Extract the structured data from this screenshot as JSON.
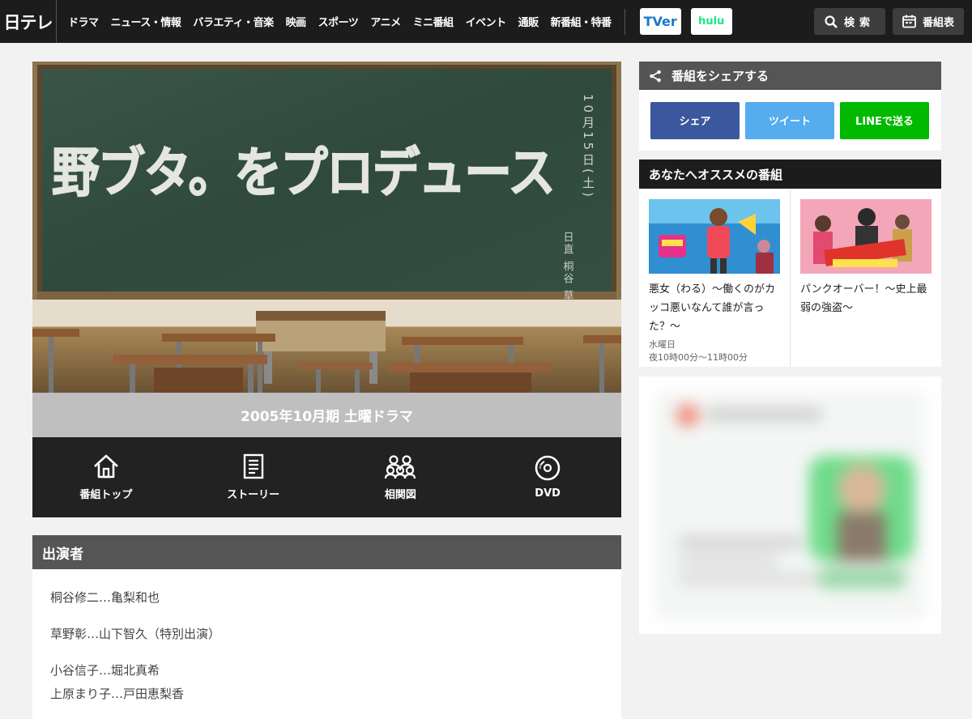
{
  "header": {
    "logo": "日テレ",
    "nav": [
      "ドラマ",
      "ニュース・情報",
      "バラエティ・音楽",
      "映画",
      "スポーツ",
      "アニメ",
      "ミニ番組",
      "イベント",
      "通販",
      "新番組・特番"
    ],
    "services": {
      "tver": "TVer",
      "hulu": "hulu"
    },
    "search_label": "検索",
    "schedule_label": "番組表"
  },
  "hero": {
    "title_chalk": "野ブタ。をプロデュース",
    "date_chalk": "10月15日(土)",
    "duty_chalk": "日直 桐谷 草野"
  },
  "season": "2005年10月期 土曜ドラマ",
  "menu": [
    {
      "label": "番組トップ",
      "icon": "home-icon"
    },
    {
      "label": "ストーリー",
      "icon": "document-icon"
    },
    {
      "label": "相関図",
      "icon": "people-icon"
    },
    {
      "label": "DVD",
      "icon": "disc-icon"
    }
  ],
  "cast": {
    "heading": "出演者",
    "lines": [
      "桐谷修二…亀梨和也",
      "草野彰…山下智久（特別出演）",
      "小谷信子…堀北真希",
      "上原まり子…戸田恵梨香"
    ]
  },
  "share": {
    "heading": "番組をシェアする",
    "facebook": "シェア",
    "twitter": "ツイート",
    "line": "LINEで送る"
  },
  "recommend": {
    "heading": "あなたへオススメの番組",
    "items": [
      {
        "title": "悪女（わる）～働くのがカッコ悪いなんて誰が言った？～",
        "day": "水曜日",
        "time": "夜10時00分～11時00分"
      },
      {
        "title": "パンクオーバー！～史上最弱の強盗～",
        "day": "",
        "time": ""
      }
    ]
  },
  "colors": {
    "topbar": "#1c1c1c",
    "facebook": "#3b579d",
    "twitter": "#55acee",
    "line": "#00b900",
    "chalkboard": "#2f4a3d"
  }
}
